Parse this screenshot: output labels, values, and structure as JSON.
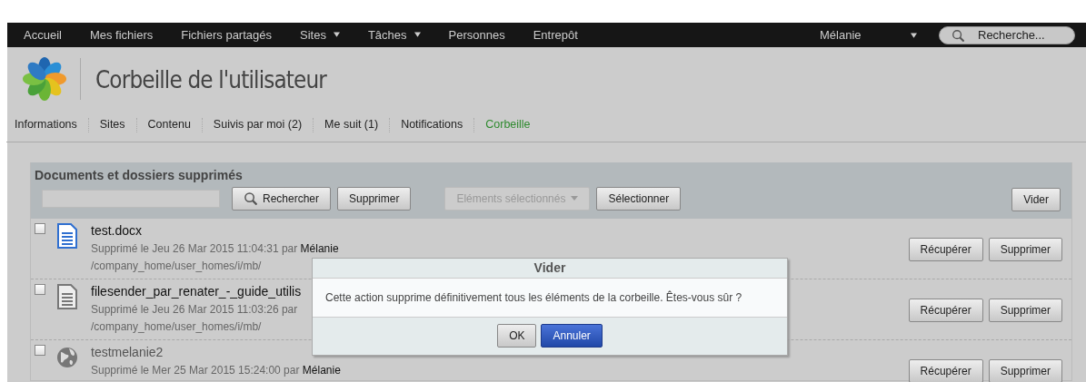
{
  "nav": {
    "items": [
      {
        "label": "Accueil",
        "dropdown": false
      },
      {
        "label": "Mes fichiers",
        "dropdown": false
      },
      {
        "label": "Fichiers partagés",
        "dropdown": false
      },
      {
        "label": "Sites",
        "dropdown": true
      },
      {
        "label": "Tâches",
        "dropdown": true
      },
      {
        "label": "Personnes",
        "dropdown": false
      },
      {
        "label": "Entrepôt",
        "dropdown": false
      }
    ],
    "user": "Mélanie",
    "search": {
      "placeholder": "Recherche..."
    }
  },
  "page_title": "Corbeille de l'utilisateur",
  "tabs": [
    {
      "label": "Informations",
      "selected": false
    },
    {
      "label": "Sites",
      "selected": false
    },
    {
      "label": "Contenu",
      "selected": false
    },
    {
      "label": "Suivis par moi (2)",
      "selected": false
    },
    {
      "label": "Me suit (1)",
      "selected": false
    },
    {
      "label": "Notifications",
      "selected": false
    },
    {
      "label": "Corbeille",
      "selected": true
    }
  ],
  "panel": {
    "title": "Documents et dossiers supprimés",
    "toolbar": [
      {
        "label": "Rechercher",
        "kind": "search",
        "disabled": false
      },
      {
        "label": "Supprimer",
        "kind": "plain",
        "disabled": false
      },
      {
        "label": "Eléments sélectionnés",
        "kind": "menu",
        "disabled": true
      },
      {
        "label": "Sélectionner",
        "kind": "plain",
        "disabled": false
      }
    ],
    "empty_button": "Vider",
    "items": [
      {
        "kind": "document",
        "checked": false,
        "name": "test.docx",
        "deleted": "Supprimé le Jeu 26 Mar 2015 11:04:31 par",
        "user": "Mélanie",
        "path": "/company_home/user_homes/i/mb/",
        "actions": [
          "Récupérer",
          "Supprimer"
        ]
      },
      {
        "kind": "text",
        "checked": false,
        "name": "filesender_par_renater_-_guide_utilis",
        "deleted": "Supprimé le Jeu 26 Mar 2015 11:03:26 par",
        "path": "/company_home/user_homes/i/mb/",
        "actions": [
          "Récupérer",
          "Supprimer"
        ]
      },
      {
        "kind": "site",
        "checked": false,
        "name": "testmelanie2",
        "deleted": "Supprimé le Mer 25 Mar 2015 15:24:00 par",
        "user": "Mélanie",
        "actions": [
          "Récupérer",
          "Supprimer"
        ]
      }
    ]
  },
  "dialog": {
    "title": "Vider",
    "message": "Cette action supprime définitivement tous les éléments de la corbeille. Êtes-vous sûr ?",
    "buttons": [
      {
        "label": "OK",
        "primary": false
      },
      {
        "label": "Annuler",
        "primary": true
      }
    ]
  }
}
